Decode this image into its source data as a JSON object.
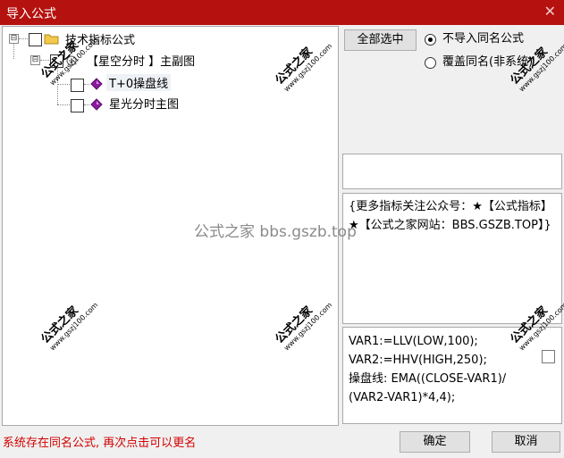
{
  "window": {
    "title": "导入公式",
    "close_glyph": "✕"
  },
  "tree": {
    "root": {
      "label": "技术指标公式",
      "expander": "⊟"
    },
    "group": {
      "label": "【星空分时 】主副图",
      "expander": "⊟"
    },
    "items": [
      {
        "label": "T+0操盘线"
      },
      {
        "label": "星光分时主图"
      }
    ]
  },
  "select_all_button": "全部选中",
  "options": [
    {
      "label": "不导入同名公式",
      "selected": true
    },
    {
      "label": "覆盖同名(非系统)",
      "selected": false
    }
  ],
  "description": "{更多指标关注公众号：★【公式指标】★【公式之家网站：BBS.GSZB.TOP】}",
  "code_lines": [
    "VAR1:=LLV(LOW,100);",
    "VAR2:=HHV(HIGH,250);",
    "操盘线: EMA((CLOSE-VAR1)/",
    "(VAR2-VAR1)*4,4);"
  ],
  "status_message": "系统存在同名公式, 再次点击可以更名",
  "ok_button": "确定",
  "cancel_button": "取消",
  "watermark": {
    "text": "公式之家",
    "url": "www.gszj100.com",
    "center": "公式之家 bbs.gszb.top"
  },
  "colors": {
    "titlebar": "#b5120f",
    "status_text": "#d20000",
    "icon_diamond": "#8a1ca0"
  }
}
